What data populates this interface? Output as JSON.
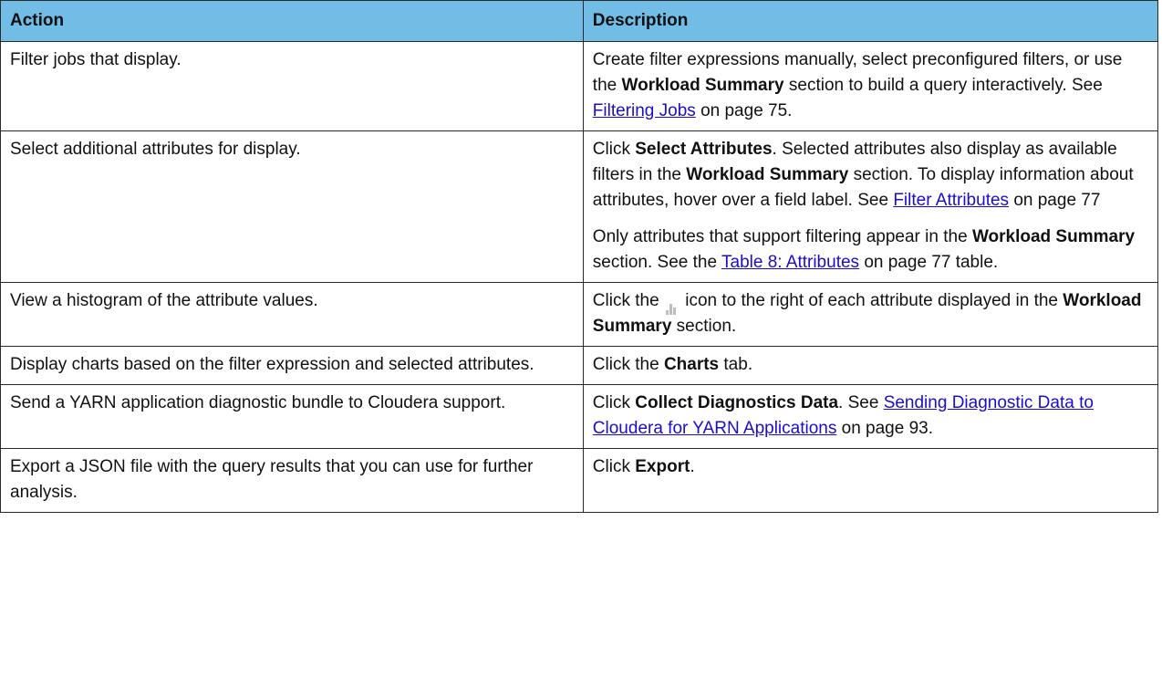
{
  "table": {
    "headers": {
      "action": "Action",
      "description": "Description"
    },
    "rows": [
      {
        "action": "Filter jobs that display.",
        "desc": {
          "t1": "Create filter expressions manually, select preconfigured filters, or use the ",
          "b1": "Workload Summary",
          "t2": " section to build a query interactively. See ",
          "link": "Filtering Jobs",
          "t3": " on page 75."
        }
      },
      {
        "action": "Select additional attributes for display.",
        "desc": {
          "p1": {
            "b1": "Select Attributes",
            "t1": ". Selected attributes also display as available filters in the ",
            "b2": "Workload Summary",
            "t2": " section. To display information about attributes, hover over a field label. See ",
            "link": "Filter Attributes",
            "t3": " on page 77",
            "t0": "Click "
          },
          "p2": {
            "t1": "Only attributes that support filtering appear in the ",
            "b1": "Workload Summary",
            "t2": " section. See the ",
            "link": "Table 8: Attributes",
            "t3": " on page 77 table."
          }
        }
      },
      {
        "action": "View a histogram of the attribute values.",
        "desc": {
          "t1": "Click the ",
          "icon": "histogram-icon",
          "t2": " icon to the right of each attribute displayed in the ",
          "b1": "Workload Summary",
          "t3": " section."
        }
      },
      {
        "action": "Display charts based on the filter expression and selected attributes.",
        "desc": {
          "t1": "Click the ",
          "b1": "Charts",
          "t2": " tab."
        }
      },
      {
        "action": "Send a YARN application diagnostic bundle to Cloudera support.",
        "desc": {
          "t1": "Click ",
          "b1": "Collect Diagnostics Data",
          "t2": ". See ",
          "link": "Sending Diagnostic Data to Cloudera for YARN Applications",
          "t3": " on page 93."
        }
      },
      {
        "action": "Export a JSON file with the query results that you can use for further analysis.",
        "desc": {
          "t1": "Click ",
          "b1": "Export",
          "t2": "."
        }
      }
    ]
  },
  "colors": {
    "header_bg": "#71bde6",
    "link": "#1a0dcc",
    "border": "#2a2a2a"
  }
}
